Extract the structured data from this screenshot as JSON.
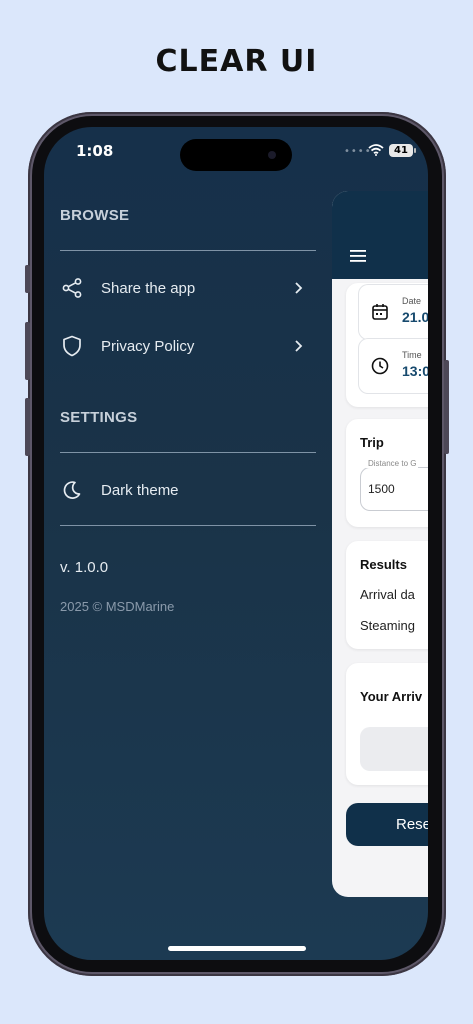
{
  "headline": "CLEAR UI",
  "status_bar": {
    "time": "1:08",
    "signal": "••••",
    "battery": "41"
  },
  "drawer": {
    "browse_title": "BROWSE",
    "items": [
      {
        "label": "Share the app",
        "icon": "share-icon"
      },
      {
        "label": "Privacy Policy",
        "icon": "shield-icon"
      }
    ],
    "settings_title": "SETTINGS",
    "settings_items": [
      {
        "label": "Dark theme",
        "icon": "moon-icon"
      }
    ],
    "version": "v. 1.0.0",
    "copyright": "2025 © MSDMarine"
  },
  "background_app": {
    "date_label": "Date",
    "date_value": "21.0",
    "time_label": "Time",
    "time_value": "13:0",
    "trip_title": "Trip",
    "distance_label": "Distance to G",
    "distance_value": "1500",
    "results_title": "Results",
    "arrival_label": "Arrival da",
    "steaming_label": "Steaming",
    "your_arrival_title": "Your Arriv",
    "reset_label": "Rese"
  },
  "colors": {
    "background": "#dbe7fb",
    "drawer_bg": "#16304a",
    "accent": "#10304a",
    "date_value": "#174a6e"
  }
}
